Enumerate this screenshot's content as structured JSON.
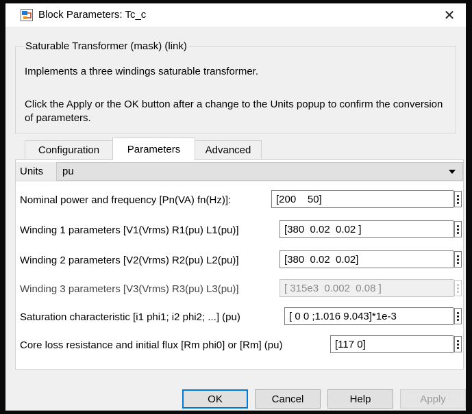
{
  "window": {
    "title": "Block Parameters: Tc_c",
    "close_symbol": "✕",
    "app_icon": "simulink-block-icon"
  },
  "mask": {
    "group_title": "Saturable Transformer (mask) (link)",
    "description_line1": "Implements a three windings saturable transformer.",
    "description_line2": "Click the Apply or the OK button after a change to the Units popup to confirm the conversion of parameters."
  },
  "tabs": [
    {
      "label": "Configuration",
      "active": false
    },
    {
      "label": "Parameters",
      "active": true
    },
    {
      "label": "Advanced",
      "active": false
    }
  ],
  "units": {
    "label": "Units",
    "value": "pu"
  },
  "parameters": [
    {
      "label": "Nominal power and frequency [Pn(VA) fn(Hz)]:",
      "value": "[200    50]",
      "enabled": true
    },
    {
      "label": "Winding 1 parameters [V1(Vrms) R1(pu) L1(pu)]",
      "value": "[380  0.02  0.02 ]",
      "enabled": true
    },
    {
      "label": "Winding 2 parameters [V2(Vrms) R2(pu) L2(pu)]",
      "value": "[380  0.02  0.02]",
      "enabled": true
    },
    {
      "label": "Winding 3 parameters [V3(Vrms) R3(pu) L3(pu)]",
      "value": "[ 315e3  0.002  0.08 ]",
      "enabled": false
    },
    {
      "label": "Saturation characteristic [i1 phi1; i2 phi2; ...] (pu)",
      "value": "[ 0 0 ;1.016 9.043]*1e-3",
      "enabled": true
    },
    {
      "label": "Core loss resistance and initial flux [Rm phi0] or [Rm] (pu)",
      "value": "[117 0]",
      "enabled": true
    }
  ],
  "buttons": {
    "ok": "OK",
    "cancel": "Cancel",
    "help": "Help",
    "apply": "Apply"
  },
  "colors": {
    "default_button_border": "#0078d7",
    "dialog_background": "#f0f0f0"
  }
}
